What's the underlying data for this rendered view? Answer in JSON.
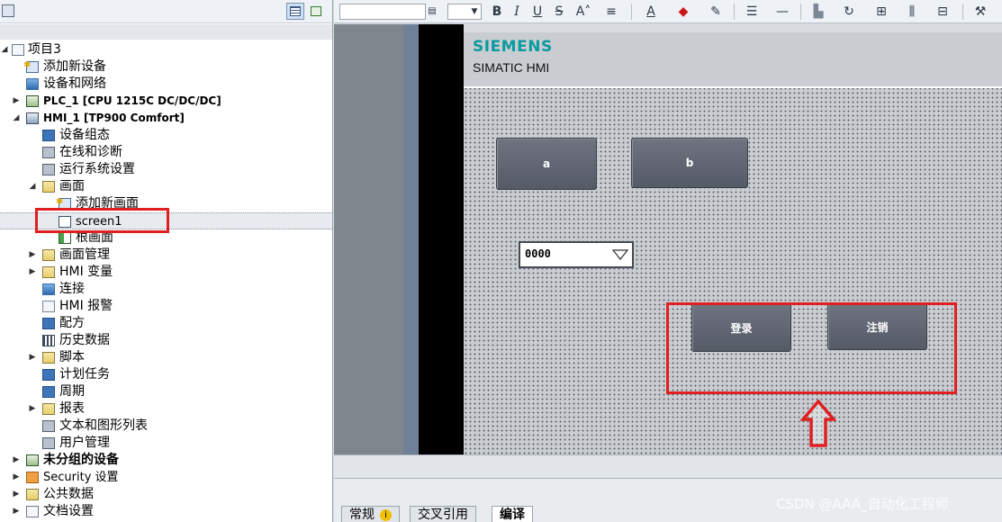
{
  "project_tree": {
    "items": [
      {
        "label": "项目3",
        "icon": "project-icon"
      },
      {
        "label": "添加新设备",
        "icon": "add-device-icon"
      },
      {
        "label": "设备和网络",
        "icon": "network-icon"
      },
      {
        "label": "PLC_1 [CPU 1215C DC/DC/DC]",
        "icon": "plc-icon"
      },
      {
        "label": "HMI_1 [TP900 Comfort]",
        "icon": "hmi-device-icon"
      },
      {
        "label": "设备组态",
        "icon": "device-config-icon"
      },
      {
        "label": "在线和诊断",
        "icon": "diagnostics-icon"
      },
      {
        "label": "运行系统设置",
        "icon": "runtime-settings-icon"
      },
      {
        "label": "画面",
        "icon": "folder-icon"
      },
      {
        "label": "添加新画面",
        "icon": "add-screen-icon"
      },
      {
        "label": "screen1",
        "icon": "screen-icon"
      },
      {
        "label": "根画面",
        "icon": "root-screen-icon"
      },
      {
        "label": "画面管理",
        "icon": "folder-icon"
      },
      {
        "label": "HMI 变量",
        "icon": "folder-icon"
      },
      {
        "label": "连接",
        "icon": "connection-icon"
      },
      {
        "label": "HMI 报警",
        "icon": "alarm-icon"
      },
      {
        "label": "配方",
        "icon": "recipe-icon"
      },
      {
        "label": "历史数据",
        "icon": "history-icon"
      },
      {
        "label": "脚本",
        "icon": "folder-icon"
      },
      {
        "label": "计划任务",
        "icon": "schedule-icon"
      },
      {
        "label": "周期",
        "icon": "cycle-icon"
      },
      {
        "label": "报表",
        "icon": "folder-icon"
      },
      {
        "label": "文本和图形列表",
        "icon": "text-graphics-list-icon"
      },
      {
        "label": "用户管理",
        "icon": "user-admin-icon"
      },
      {
        "label": "未分组的设备",
        "icon": "ungrouped-devices-icon"
      },
      {
        "label": "Security 设置",
        "icon": "security-icon"
      },
      {
        "label": "公共数据",
        "icon": "common-data-icon"
      },
      {
        "label": "文档设置",
        "icon": "document-settings-icon"
      }
    ]
  },
  "hmi_screen": {
    "brand": "SIEMENS",
    "subtitle": "SIMATIC HMI",
    "buttons": {
      "a": "a",
      "b": "b",
      "login": "登录",
      "logout": "注销"
    },
    "io_field_value": "0000"
  },
  "bottom_tabs": {
    "general": "常规",
    "cross_ref": "交叉引用",
    "compile": "编译"
  },
  "watermark": "CSDN @AAA_自动化工程师",
  "colors": {
    "highlight_red": "#e02020",
    "brand_teal": "#0a9aa0",
    "hmi_button": "#5e6470"
  }
}
